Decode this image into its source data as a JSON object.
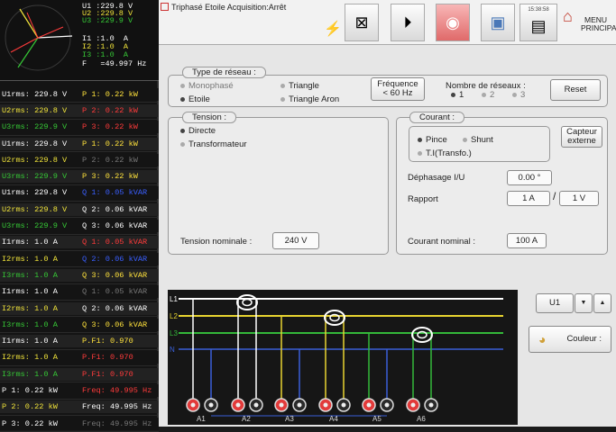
{
  "vector_panel": {
    "u1": "U1 :229.8 V",
    "u2": "U2 :229.8 V",
    "u3": "U3 :229.9 V",
    "i1": "I1 :1.0  A",
    "i2": "I2 :1.0  A",
    "i3": "I3 :1.0  A",
    "f": "F   =49.997 Hz"
  },
  "measure_rows": [
    {
      "a": "U1rms: 229.8 V",
      "b": "P 1: 0.22 kW",
      "ca": "#ffffff",
      "cb": "#ffe23c",
      "bga": "#141414",
      "bgb": "#141414"
    },
    {
      "a": "U2rms: 229.8 V",
      "b": "P 2: 0.22 kW",
      "ca": "#f0e33a",
      "cb": "#ff3b3b",
      "bga": "#222",
      "bgb": "#222"
    },
    {
      "a": "U3rms: 229.9 V",
      "b": "P 3: 0.22 kW",
      "ca": "#36c836",
      "cb": "#ff3b3b",
      "bga": "#141414",
      "bgb": "#141414"
    },
    {
      "a": "U1rms: 229.8 V",
      "b": "P 1: 0.22 kW",
      "ca": "#ffffff",
      "cb": "#ffe23c",
      "bga": "#222",
      "bgb": "#222"
    },
    {
      "a": "U2rms: 229.8 V",
      "b": "P 2: 0.22 kW",
      "ca": "#f0e33a",
      "cb": "#777777",
      "bga": "#141414",
      "bgb": "#141414"
    },
    {
      "a": "U3rms: 229.9 V",
      "b": "P 3: 0.22 kW",
      "ca": "#36c836",
      "cb": "#ffe23c",
      "bga": "#222",
      "bgb": "#222"
    },
    {
      "a": "U1rms: 229.8 V",
      "b": "Q 1: 0.05 kVAR",
      "ca": "#ffffff",
      "cb": "#3a5fff",
      "bga": "#141414",
      "bgb": "#141414"
    },
    {
      "a": "U2rms: 229.8 V",
      "b": "Q 2: 0.06 kVAR",
      "ca": "#f0e33a",
      "cb": "#ffffff",
      "bga": "#222",
      "bgb": "#222"
    },
    {
      "a": "U3rms: 229.9 V",
      "b": "Q 3: 0.06 kVAR",
      "ca": "#36c836",
      "cb": "#ffffff",
      "bga": "#141414",
      "bgb": "#141414"
    },
    {
      "a": "I1rms: 1.0 A",
      "b": "Q 1: 0.05 kVAR",
      "ca": "#ffffff",
      "cb": "#ff3b3b",
      "bga": "#222",
      "bgb": "#222"
    },
    {
      "a": "I2rms: 1.0 A",
      "b": "Q 2: 0.06 kVAR",
      "ca": "#f0e33a",
      "cb": "#3a5fff",
      "bga": "#141414",
      "bgb": "#141414"
    },
    {
      "a": "I3rms: 1.0 A",
      "b": "Q 3: 0.06 kVAR",
      "ca": "#36c836",
      "cb": "#ffe23c",
      "bga": "#222",
      "bgb": "#222"
    },
    {
      "a": "I1rms: 1.0 A",
      "b": "Q 1: 0.05 kVAR",
      "ca": "#ffffff",
      "cb": "#777777",
      "bga": "#141414",
      "bgb": "#141414"
    },
    {
      "a": "I2rms: 1.0 A",
      "b": "Q 2: 0.06 kVAR",
      "ca": "#f0e33a",
      "cb": "#ffffff",
      "bga": "#222",
      "bgb": "#222"
    },
    {
      "a": "I3rms: 1.0 A",
      "b": "Q 3: 0.06 kVAR",
      "ca": "#36c836",
      "cb": "#ffe23c",
      "bga": "#141414",
      "bgb": "#141414"
    },
    {
      "a": "I1rms: 1.0 A",
      "b": "P.F1: 0.970",
      "ca": "#ffffff",
      "cb": "#ffe23c",
      "bga": "#222",
      "bgb": "#222"
    },
    {
      "a": "I2rms: 1.0 A",
      "b": "P.F1: 0.970",
      "ca": "#f0e33a",
      "cb": "#ff3b3b",
      "bga": "#141414",
      "bgb": "#141414"
    },
    {
      "a": "I3rms: 1.0 A",
      "b": "P.F1: 0.970",
      "ca": "#36c836",
      "cb": "#ff3b3b",
      "bga": "#222",
      "bgb": "#222"
    },
    {
      "a": "P 1: 0.22 kW",
      "b": "Freq: 49.995 Hz",
      "ca": "#ffffff",
      "cb": "#ff3b3b",
      "bga": "#141414",
      "bgb": "#141414"
    },
    {
      "a": "P 2: 0.22 kW",
      "b": "Freq: 49.995 Hz",
      "ca": "#f0e33a",
      "cb": "#ffffff",
      "bga": "#222",
      "bgb": "#222"
    },
    {
      "a": "P 3: 0.22 kW",
      "b": "Freq: 49.995 Hz",
      "ca": "#ffffff",
      "cb": "#777777",
      "bga": "#141414",
      "bgb": "#141414"
    }
  ],
  "toolbar": {
    "title": "Triphasé Etoile Acquisition:Arrêt",
    "clock": "15:38:58",
    "menu_line1": "MENU",
    "menu_line2": "PRINCIPAL"
  },
  "reseau": {
    "legend": "Type de réseau :",
    "monophase": "Monophasé",
    "triangle": "Triangle",
    "etoile": "Etoile",
    "triangle_aron": "Triangle Aron",
    "freq_line1": "Fréquence",
    "freq_line2": "< 60 Hz",
    "nb_label": "Nombre de réseaux :",
    "nb_opts": [
      "1",
      "2",
      "3"
    ],
    "reset": "Reset"
  },
  "tension": {
    "legend": "Tension :",
    "directe": "Directe",
    "transformateur": "Transformateur",
    "nominal_label": "Tension nominale :",
    "nominal_value": "240 V"
  },
  "courant": {
    "legend": "Courant        :",
    "pince": "Pince",
    "shunt": "Shunt",
    "ti": "T.I(Transfo.)",
    "capteur_line1": "Capteur",
    "capteur_line2": "externe",
    "dephasage_label": "Déphasage I/U",
    "dephasage_value": "0.00 °",
    "rapport_label": "Rapport",
    "rapport_a": "1 A",
    "rapport_sep": "/",
    "rapport_b": "1 V",
    "nominal_label": "Courant nominal  :",
    "nominal_value": "100 A"
  },
  "diagram": {
    "l1": "L1",
    "l2": "L2",
    "l3": "L3",
    "n": "N",
    "channels": [
      "A1",
      "A2",
      "A3",
      "A4",
      "A5",
      "A6"
    ]
  },
  "side": {
    "select_value": "U1",
    "couleur": "Couleur :"
  },
  "colors": {
    "l1": "#ffffff",
    "l2": "#e8d430",
    "l3": "#34b83a",
    "n": "#3a5fd8",
    "terminal_red": "#e23a3a"
  }
}
